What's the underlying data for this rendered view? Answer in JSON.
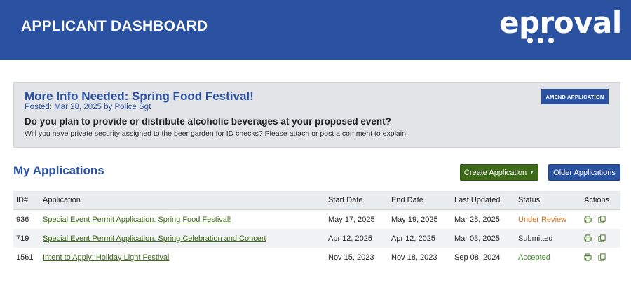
{
  "header": {
    "title": "APPLICANT DASHBOARD",
    "logo_text": "eproval"
  },
  "alert": {
    "title": "More Info Needed: Spring Food Festival!",
    "meta": "Posted: Mar 28, 2025 by Police Sgt",
    "question": "Do you plan to provide or distribute alcoholic beverages at your proposed event?",
    "detail": "Will you have private security assigned to the beer garden for ID checks? Please attach or post a comment to explain.",
    "amend_label": "AMEND APPLICATION"
  },
  "applications": {
    "title": "My Applications",
    "create_label": "Create Application",
    "older_label": "Older Applications",
    "columns": [
      "ID#",
      "Application",
      "Start Date",
      "End Date",
      "Last Updated",
      "Status",
      "Actions"
    ],
    "rows": [
      {
        "id": "936",
        "name": "Special Event Permit Application: Spring Food Festival!",
        "start": "May 17, 2025",
        "end": "May 19, 2025",
        "updated": "Mar 28, 2025",
        "status": "Under Review"
      },
      {
        "id": "719",
        "name": "Special Event Permit Application: Spring Celebration and Concert",
        "start": "Apr 12, 2025",
        "end": "Apr 12, 2025",
        "updated": "Mar 03, 2025",
        "status": "Submitted"
      },
      {
        "id": "1561",
        "name": "Intent to Apply: Holiday Light Festival",
        "start": "Nov 15, 2023",
        "end": "Nov 18, 2023",
        "updated": "Sep 08, 2024",
        "status": "Accepted"
      }
    ],
    "action_separator": "|"
  },
  "colors": {
    "brand_blue": "#2a52a0",
    "create_green": "#3e6b1a",
    "status_review": "#d2731b",
    "status_accepted": "#3f8a2c"
  },
  "icons": {
    "print": "print-icon",
    "copy": "copy-icon",
    "caret": "caret-down-icon"
  }
}
